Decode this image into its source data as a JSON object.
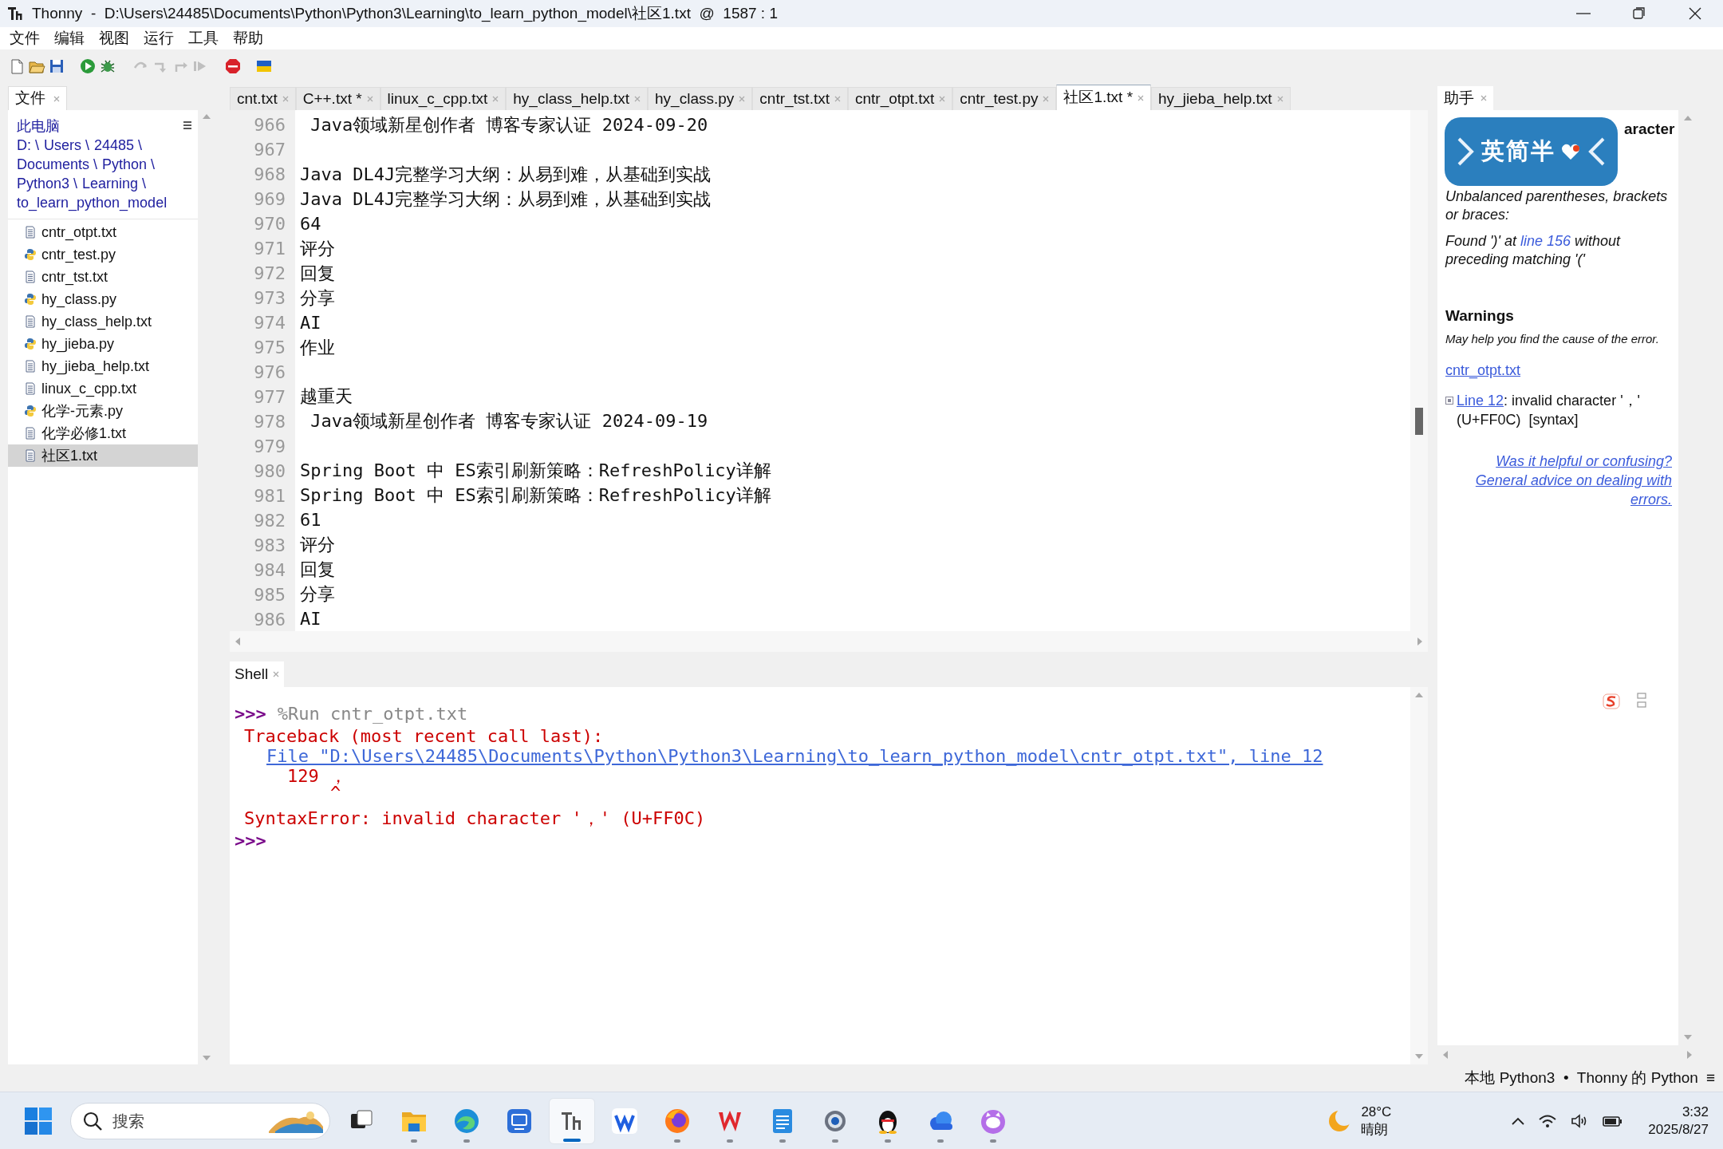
{
  "window": {
    "title": "Thonny  -  D:\\Users\\24485\\Documents\\Python\\Python3\\Learning\\to_learn_python_model\\社区1.txt  @  1587 : 1"
  },
  "menu": [
    "文件",
    "编辑",
    "视图",
    "运行",
    "工具",
    "帮助"
  ],
  "toolbar": [
    {
      "kind": "new",
      "disabled": false
    },
    {
      "kind": "open",
      "disabled": false
    },
    {
      "kind": "save",
      "disabled": false
    },
    {
      "kind": "run",
      "disabled": false
    },
    {
      "kind": "debug",
      "disabled": false
    },
    {
      "kind": "step_over",
      "disabled": true
    },
    {
      "kind": "step_into",
      "disabled": true
    },
    {
      "kind": "step_out",
      "disabled": true
    },
    {
      "kind": "resume",
      "disabled": true
    },
    {
      "kind": "stop",
      "disabled": false
    },
    {
      "kind": "flag",
      "disabled": false
    }
  ],
  "files_panel": {
    "tab": "文件",
    "computer": "此电脑",
    "path": [
      "D: \\",
      "Users \\",
      "24485 \\",
      "Documents \\",
      "Python \\",
      "Python3 \\",
      "Learning \\",
      "to_learn_python_model"
    ],
    "files": [
      {
        "name": "cntr_otpt.txt",
        "kind": "txt",
        "selected": false
      },
      {
        "name": "cntr_test.py",
        "kind": "py",
        "selected": false
      },
      {
        "name": "cntr_tst.txt",
        "kind": "txt",
        "selected": false
      },
      {
        "name": "hy_class.py",
        "kind": "py",
        "selected": false
      },
      {
        "name": "hy_class_help.txt",
        "kind": "txt",
        "selected": false
      },
      {
        "name": "hy_jieba.py",
        "kind": "py",
        "selected": false
      },
      {
        "name": "hy_jieba_help.txt",
        "kind": "txt",
        "selected": false
      },
      {
        "name": "linux_c_cpp.txt",
        "kind": "txt",
        "selected": false
      },
      {
        "name": "化学-元素.py",
        "kind": "py",
        "selected": false
      },
      {
        "name": "化学必修1.txt",
        "kind": "txt",
        "selected": false
      },
      {
        "name": "社区1.txt",
        "kind": "txt",
        "selected": true
      }
    ]
  },
  "editor": {
    "tabs": [
      {
        "label": "cnt.txt",
        "selected": false
      },
      {
        "label": "C++.txt *",
        "selected": false
      },
      {
        "label": "linux_c_cpp.txt",
        "selected": false
      },
      {
        "label": "hy_class_help.txt",
        "selected": false
      },
      {
        "label": "hy_class.py",
        "selected": false
      },
      {
        "label": "cntr_tst.txt",
        "selected": false
      },
      {
        "label": "cntr_otpt.txt",
        "selected": false
      },
      {
        "label": "cntr_test.py",
        "selected": false
      },
      {
        "label": "社区1.txt *",
        "selected": true
      },
      {
        "label": "hy_jieba_help.txt",
        "selected": false
      }
    ],
    "lines": [
      {
        "number": "966",
        "text": " Java领域新星创作者 博客专家认证 2024-09-20"
      },
      {
        "number": "967"
      },
      {
        "number": "968",
        "text": "Java DL4J完整学习大纲：从易到难，从基础到实战"
      },
      {
        "number": "969",
        "text": "Java DL4J完整学习大纲：从易到难，从基础到实战"
      },
      {
        "number": "970",
        "text": "64"
      },
      {
        "number": "971",
        "text": "评分"
      },
      {
        "number": "972",
        "text": "回复"
      },
      {
        "number": "973",
        "text": "分享"
      },
      {
        "number": "974",
        "text": "AI"
      },
      {
        "number": "975",
        "text": "作业"
      },
      {
        "number": "976"
      },
      {
        "number": "977",
        "text": "越重天"
      },
      {
        "number": "978",
        "text": " Java领域新星创作者 博客专家认证 2024-09-19"
      },
      {
        "number": "979"
      },
      {
        "number": "980",
        "text": "Spring Boot 中 ES索引刷新策略：RefreshPolicy详解"
      },
      {
        "number": "981",
        "text": "Spring Boot 中 ES索引刷新策略：RefreshPolicy详解"
      },
      {
        "number": "982",
        "text": "61"
      },
      {
        "number": "983",
        "text": "评分"
      },
      {
        "number": "984",
        "text": "回复"
      },
      {
        "number": "985",
        "text": "分享"
      },
      {
        "number": "986",
        "text": "AI"
      }
    ]
  },
  "shell": {
    "tab": "Shell",
    "lines": [
      {
        "kind": "command",
        "prompt": ">>>",
        "text": "%Run cntr_otpt.txt"
      },
      {
        "kind": "error",
        "text": "Traceback (most recent call last):"
      },
      {
        "kind": "location",
        "text": "File \"D:\\Users\\24485\\Documents\\Python\\Python3\\Learning\\to_learn_python_model\\cntr_otpt.txt\", line 12"
      },
      {
        "kind": "source",
        "text": "129 ，"
      },
      {
        "kind": "caret",
        "text": "^"
      },
      {
        "kind": "error_gap",
        "text": "SyntaxError: invalid character '，' (U+FF0C)"
      },
      {
        "kind": "command",
        "prompt": ">>>"
      }
    ]
  },
  "assistant": {
    "tab": "助手",
    "heading": "aracter",
    "intro": "Unbalanced parentheses, brackets or braces:",
    "found_before": "Found ')' at ",
    "found_link": "line 156",
    "found_after": " without preceding matching '('",
    "warnings_title": "Warnings",
    "warnings_subtitle": "May help you find the cause of the error.",
    "file_link": "cntr_otpt.txt",
    "warning_link": "Line 12",
    "warning_text": ": invalid character '，' (U+FF0C)  [syntax]",
    "feedback_link": "Was it helpful or confusing?",
    "advice_link": "General advice on dealing with errors."
  },
  "ime_bar": {
    "text": "英简半"
  },
  "status_bar": {
    "interpreter": "本地 Python3  •  Thonny 的 Python",
    "menu_glyph": "≡"
  },
  "taskbar": {
    "search_placeholder": "搜索",
    "apps": [
      {
        "kind": "task_view",
        "running": false,
        "selected": false
      },
      {
        "kind": "folder",
        "running": true,
        "selected": false
      },
      {
        "kind": "browser_wave",
        "running": true,
        "selected": false
      },
      {
        "kind": "remote",
        "running": false,
        "selected": false
      },
      {
        "kind": "thonny",
        "running": true,
        "selected": true
      },
      {
        "kind": "blue_w",
        "running": false,
        "selected": false
      },
      {
        "kind": "fox_browser",
        "running": true,
        "selected": false
      },
      {
        "kind": "red_w",
        "running": true,
        "selected": false
      },
      {
        "kind": "notepad",
        "running": true,
        "selected": false
      },
      {
        "kind": "settings",
        "running": true,
        "selected": false
      },
      {
        "kind": "penguin",
        "running": true,
        "selected": false
      },
      {
        "kind": "cloud",
        "running": true,
        "selected": false
      },
      {
        "kind": "cat",
        "running": true,
        "selected": false
      }
    ],
    "weather": {
      "temperature": "28°C",
      "condition": "晴朗"
    },
    "time": "3:32",
    "date": "2025/8/27"
  }
}
